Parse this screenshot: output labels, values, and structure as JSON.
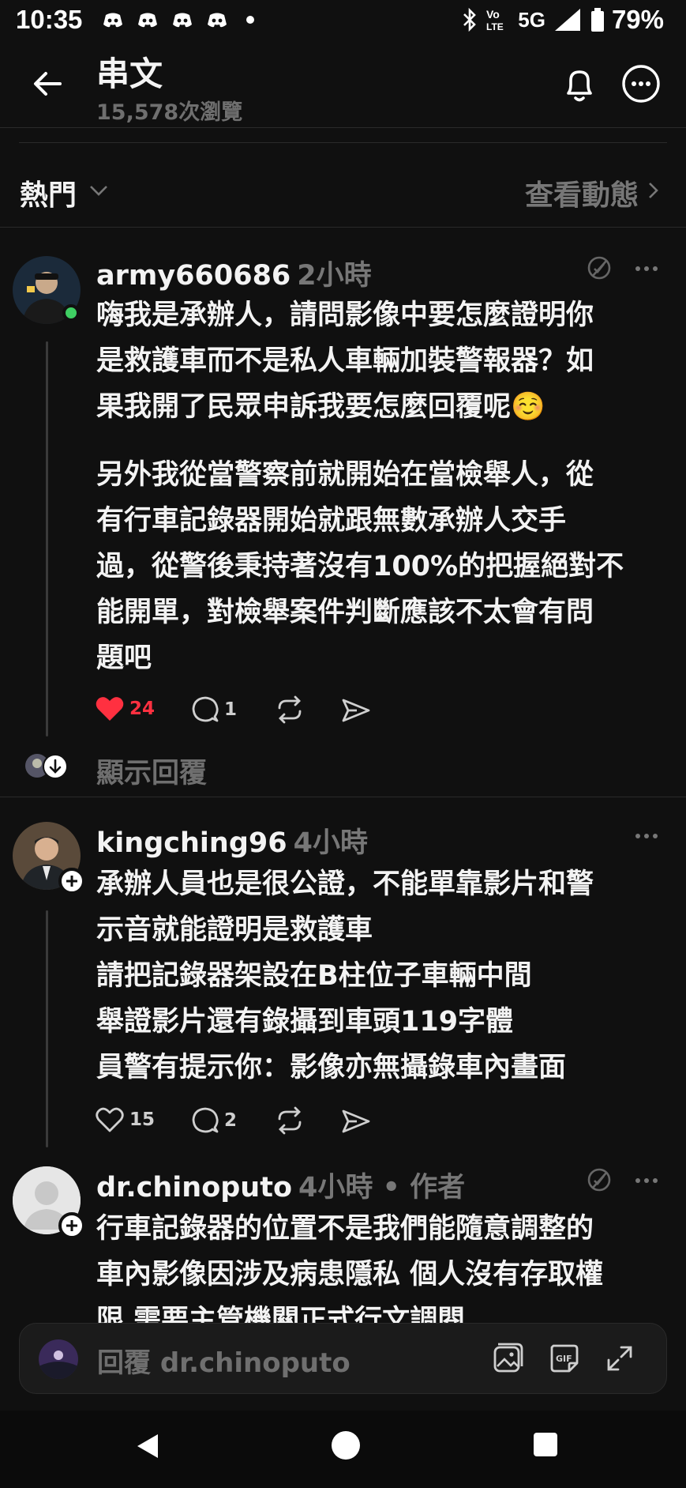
{
  "status_bar": {
    "time": "10:35",
    "network": "5G",
    "volte": "Vo LTE",
    "battery": "79%"
  },
  "header": {
    "title": "串文",
    "views": "15,578次瀏覽"
  },
  "sort": {
    "label": "熱門",
    "view_activity": "查看動態"
  },
  "posts": [
    {
      "username": "army660686",
      "time": "2小時",
      "paragraphs": [
        [
          "嗨我是承辦人，請問影像中要怎麼證明你",
          "是救護車而不是私人車輛加裝警報器？如",
          "果我開了民眾申訴我要怎麼回覆呢☺️"
        ],
        [
          "另外我從當警察前就開始在當檢舉人，從",
          "有行車記錄器開始就跟無數承辦人交手",
          "過，從警後秉持著沒有100%的把握絕對不",
          "能開單，對檢舉案件判斷應該不太會有問",
          "題吧"
        ]
      ],
      "likes": "24",
      "liked": true,
      "comments": "1",
      "show_replies": "顯示回覆"
    },
    {
      "username": "kingching96",
      "time": "4小時",
      "lines": [
        "承辦人員也是很公證，不能單靠影片和警",
        "示音就能證明是救護車",
        "請把記錄器架設在B柱位子車輛中間",
        "舉證影片還有錄攝到車頭119字體",
        "員警有提示你：影像亦無攝錄車內畫面"
      ],
      "likes": "15",
      "liked": false,
      "comments": "2"
    },
    {
      "username": "dr.chinoputo",
      "time": "4小時 • 作者",
      "lines": [
        "行車記錄器的位置不是我們能隨意調整的",
        "車內影像因涉及病患隱私 個人沒有存取權",
        "限 需要主管機關正式行文調閱"
      ]
    }
  ],
  "reply_bar": {
    "placeholder": "回覆 dr.chinoputo"
  },
  "colors": {
    "background": "#101010",
    "like_red": "#ff3040",
    "muted": "#777777",
    "online_green": "#3fcf63"
  }
}
